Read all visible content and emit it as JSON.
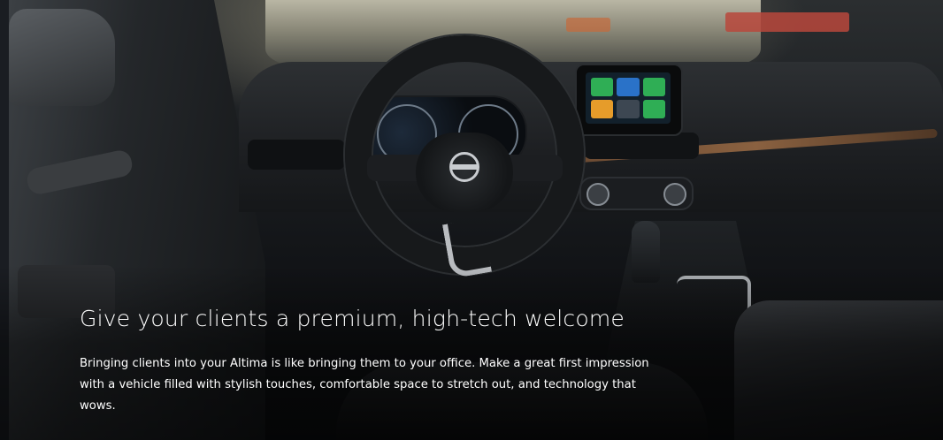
{
  "hero": {
    "headline": "Give your clients a premium, high-tech welcome",
    "body": "Bringing clients into your Altima is like bringing them to your office. Make a great first impression with a vehicle filled with stylish touches, comfortable space to stretch out, and technology that wows."
  },
  "image": {
    "subject": "nissan-altima-interior",
    "icons": [
      "nissan-logo-icon",
      "steering-wheel-icon"
    ]
  }
}
